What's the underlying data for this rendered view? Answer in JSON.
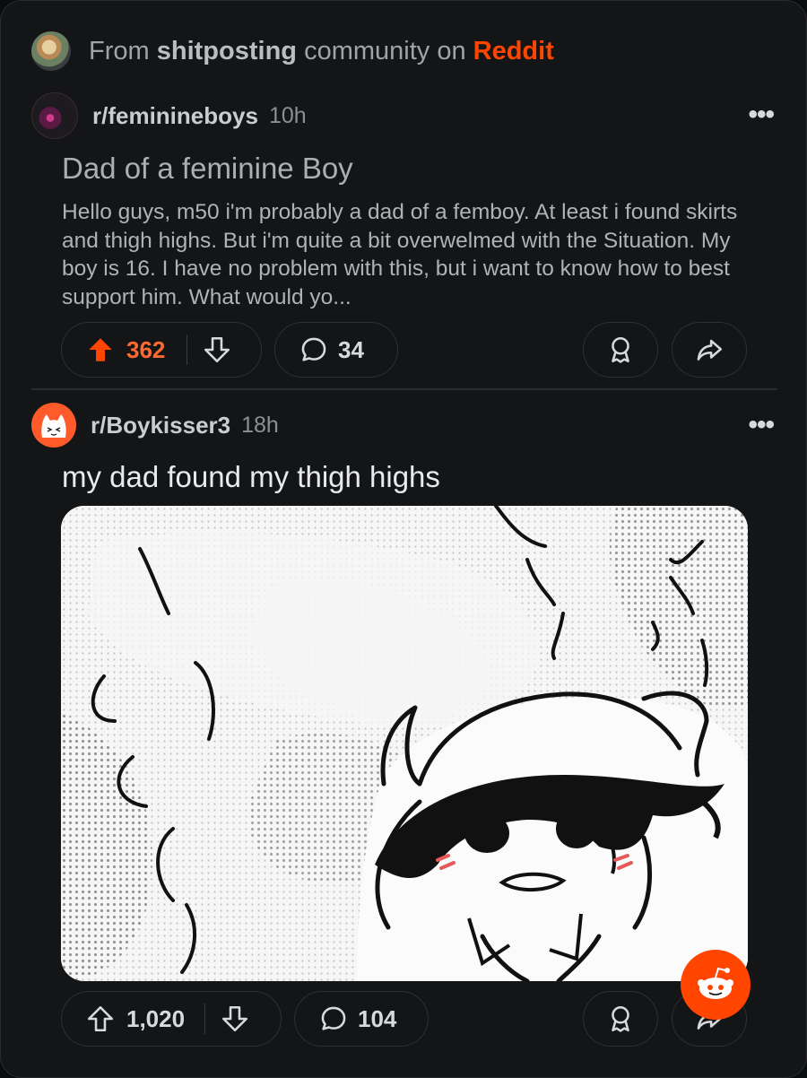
{
  "crosspost": {
    "prefix": "From",
    "community": "shitposting",
    "middle": "community on",
    "platform": "Reddit"
  },
  "posts": [
    {
      "subreddit": "r/feminineboys",
      "time": "10h",
      "title": "Dad of a feminine Boy",
      "body": "Hello guys, m50 i'm probably a dad of a femboy. At least i found skirts and thigh highs. But i'm quite a bit overwelmed with the Situation. My boy is 16. I have no problem with this, but i want to know how to best support him. What would yo...",
      "upvotes": "362",
      "comments": "34",
      "upvoted": true
    },
    {
      "subreddit": "r/Boykisser3",
      "time": "18h",
      "title": "my dad found my thigh highs",
      "upvotes": "1,020",
      "comments": "104",
      "upvoted": false
    }
  ],
  "colors": {
    "accent": "#ff4500",
    "background": "#141516"
  },
  "icons": [
    "upvote-icon",
    "downvote-icon",
    "comment-icon",
    "award-icon",
    "share-icon",
    "more-icon",
    "reddit-snoo-icon"
  ]
}
